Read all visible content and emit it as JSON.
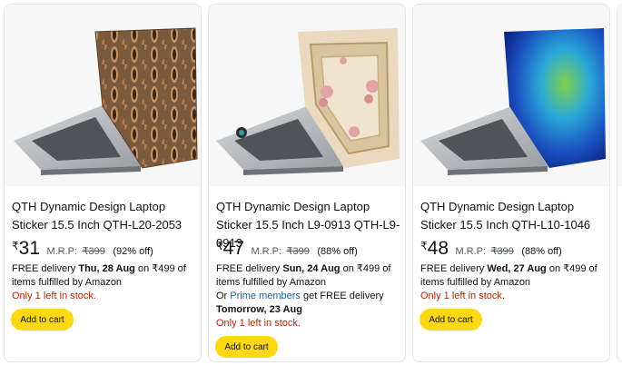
{
  "products": [
    {
      "title": "QTH Dynamic Design Laptop Sticker 15.5 Inch QTH-L20-2053",
      "price_symbol": "₹",
      "price": "31",
      "mrp_label": "M.R.P:",
      "mrp_value": "₹399",
      "discount": "(92% off)",
      "delivery_prefix": "FREE delivery",
      "delivery_date": "Thu, 28 Aug",
      "delivery_suffix": "on ₹499 of items fulfilled by Amazon",
      "stock": "Only 1 left in stock.",
      "cart_label": "Add to cart",
      "image_icon": "laptop-bronze-pattern-icon"
    },
    {
      "title": "QTH Dynamic Design Laptop Sticker 15.5 Inch L9-0913 QTH-L9-0913",
      "price_symbol": "₹",
      "price": "47",
      "mrp_label": "M.R.P:",
      "mrp_value": "₹399",
      "discount": "(88% off)",
      "delivery_prefix": "FREE delivery",
      "delivery_date": "Sun, 24 Aug",
      "delivery_suffix": "on ₹499 of items fulfilled by Amazon",
      "prime_prefix": "Or",
      "prime_link": "Prime members",
      "prime_suffix": "get FREE delivery",
      "prime_date": "Tomorrow, 23 Aug",
      "stock": "Only 1 left in stock.",
      "cart_label": "Add to cart",
      "image_icon": "laptop-floral-frame-icon"
    },
    {
      "title": "QTH Dynamic Design Laptop Sticker 15.5 Inch QTH-L10-1046",
      "price_symbol": "₹",
      "price": "48",
      "mrp_label": "M.R.P:",
      "mrp_value": "₹399",
      "discount": "(88% off)",
      "delivery_prefix": "FREE delivery",
      "delivery_date": "Wed, 27 Aug",
      "delivery_suffix": "on ₹499 of items fulfilled by Amazon",
      "stock": "Only 1 left in stock.",
      "cart_label": "Add to cart",
      "image_icon": "laptop-blue-gradient-icon"
    }
  ],
  "colors": {
    "cart_button": "#ffd814",
    "stock_text": "#b12704",
    "link": "#2162a1",
    "card_border": "#e3e6e6"
  }
}
